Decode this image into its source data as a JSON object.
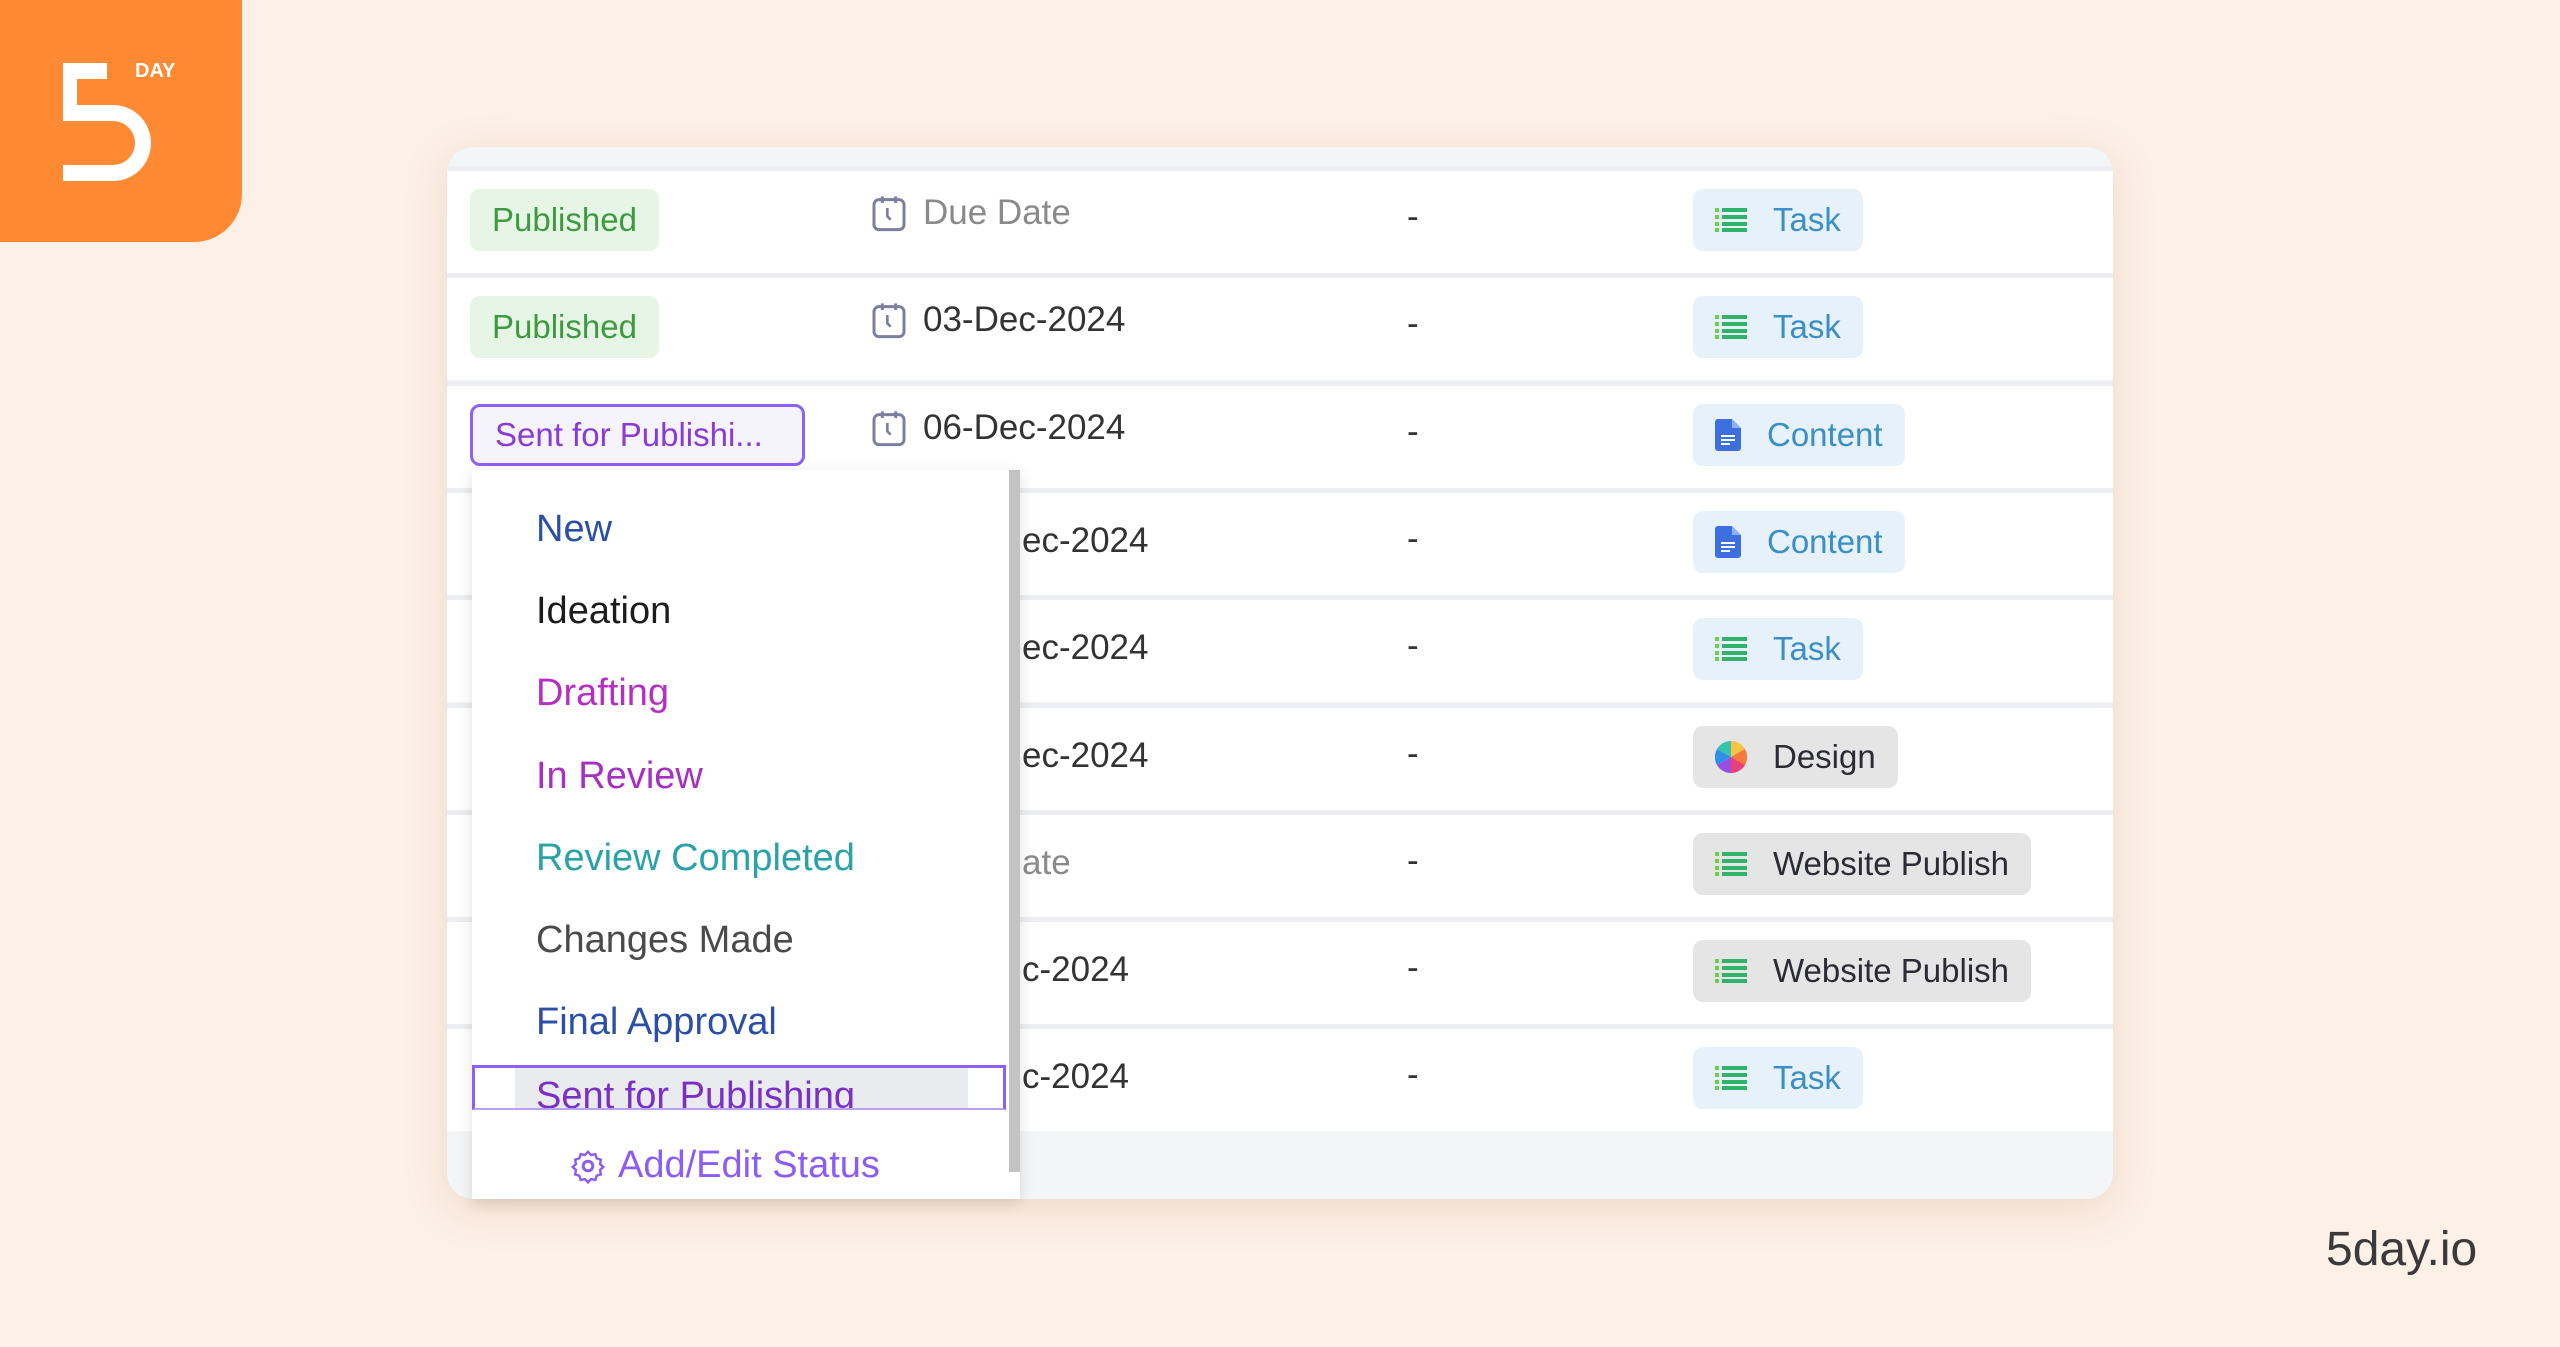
{
  "brand": {
    "logo_text": "5 DAY",
    "site": "5day.io",
    "accent": "#ff8a33"
  },
  "rows": [
    {
      "status": "Published",
      "date": "Due Date",
      "date_placeholder": true,
      "dash": "-",
      "type": "Task",
      "type_icon": "list-icon"
    },
    {
      "status": "Published",
      "date": "03-Dec-2024",
      "dash": "-",
      "type": "Task",
      "type_icon": "list-icon"
    },
    {
      "status": "Sent for Publishi...",
      "date": "06-Dec-2024",
      "dash": "-",
      "type": "Content",
      "type_icon": "document-icon",
      "selected": true
    },
    {
      "date_partial": "ec-2024",
      "dash": "-",
      "type": "Content",
      "type_icon": "document-icon"
    },
    {
      "date_partial": "ec-2024",
      "dash": "-",
      "type": "Task",
      "type_icon": "list-icon"
    },
    {
      "date_partial": "ec-2024",
      "dash": "-",
      "type": "Design",
      "type_icon": "color-wheel-icon"
    },
    {
      "date_partial": "ate",
      "date_placeholder": true,
      "dash": "-",
      "type": "Website Publish",
      "type_icon": "list-icon"
    },
    {
      "date_partial": "c-2024",
      "dash": "-",
      "type": "Website Publish",
      "type_icon": "list-icon"
    },
    {
      "date_partial": "c-2024",
      "dash": "-",
      "type": "Task",
      "type_icon": "list-icon"
    }
  ],
  "dropdown": {
    "options": [
      {
        "label": "New",
        "color": "#2b4fa8"
      },
      {
        "label": "Ideation",
        "color": "#1c1c1c"
      },
      {
        "label": "Drafting",
        "color": "#b52fc4"
      },
      {
        "label": "In Review",
        "color": "#a82fc4"
      },
      {
        "label": "Review Completed",
        "color": "#2aa3a8"
      },
      {
        "label": "Changes Made",
        "color": "#4a4a4a"
      },
      {
        "label": "Final Approval",
        "color": "#2b4fa8"
      }
    ],
    "selected": "Sent for Publishing",
    "add_edit": "Add/Edit Status"
  }
}
